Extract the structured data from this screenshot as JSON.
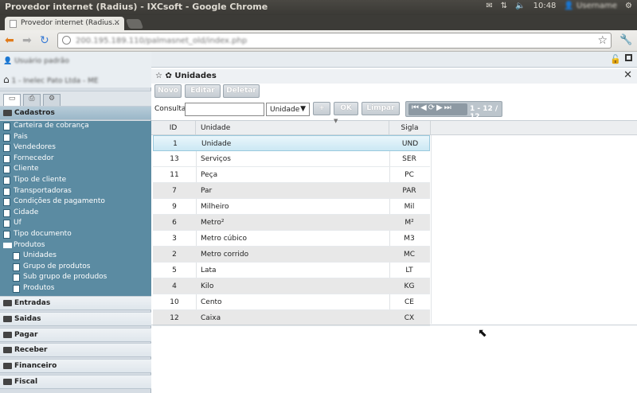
{
  "os": {
    "window_title": "Provedor internet (Radius) - IXCsoft - Google Chrome",
    "clock": "10:48"
  },
  "browser": {
    "tab_title": "Provedor internet (Radius...",
    "tab_close": "×",
    "url": "200.195.189.110/palmasnet_old/index.php"
  },
  "sidebar": {
    "user": "Usuário padrão",
    "company": "1 - Inelec Pato Ltda - ME",
    "sections": {
      "cadastros": "Cadastros",
      "entradas": "Entradas",
      "saidas": "Saidas",
      "pagar": "Pagar",
      "receber": "Receber",
      "financeiro": "Financeiro",
      "fiscal": "Fiscal"
    },
    "cadastros_items": [
      "Carteira de cobrança",
      "Pais",
      "Vendedores",
      "Fornecedor",
      "Cliente",
      "Tipo de cliente",
      "Transportadoras",
      "Condições de pagamento",
      "Cidade",
      "Uf",
      "Tipo documento",
      "Produtos"
    ],
    "produtos_items": [
      "Unidades",
      "Grupo de produtos",
      "Sub grupo de produdos",
      "Produtos"
    ]
  },
  "window": {
    "title": "Unidades",
    "buttons": {
      "novo": "Novo",
      "editar": "Editar",
      "deletar": "Deletar"
    },
    "search": {
      "label": "Consultar",
      "value": "",
      "field": "Unidade",
      "plus": "+",
      "ok": "OK",
      "clear": "Limpar"
    },
    "pager": {
      "info": "1 - 12 / 12"
    }
  },
  "grid": {
    "columns": [
      "ID",
      "Unidade",
      "Sigla"
    ],
    "rows": [
      {
        "id": "1",
        "unidade": "Unidade",
        "sigla": "UND"
      },
      {
        "id": "13",
        "unidade": "Serviços",
        "sigla": "SER"
      },
      {
        "id": "11",
        "unidade": "Peça",
        "sigla": "PC"
      },
      {
        "id": "7",
        "unidade": "Par",
        "sigla": "PAR"
      },
      {
        "id": "9",
        "unidade": "Milheiro",
        "sigla": "Mil"
      },
      {
        "id": "6",
        "unidade": "Metro²",
        "sigla": "M²"
      },
      {
        "id": "3",
        "unidade": "Metro cúbico",
        "sigla": "M3"
      },
      {
        "id": "2",
        "unidade": "Metro corrido",
        "sigla": "MC"
      },
      {
        "id": "5",
        "unidade": "Lata",
        "sigla": "LT"
      },
      {
        "id": "4",
        "unidade": "Kilo",
        "sigla": "KG"
      },
      {
        "id": "10",
        "unidade": "Cento",
        "sigla": "CE"
      },
      {
        "id": "12",
        "unidade": "Caixa",
        "sigla": "CX"
      }
    ]
  }
}
